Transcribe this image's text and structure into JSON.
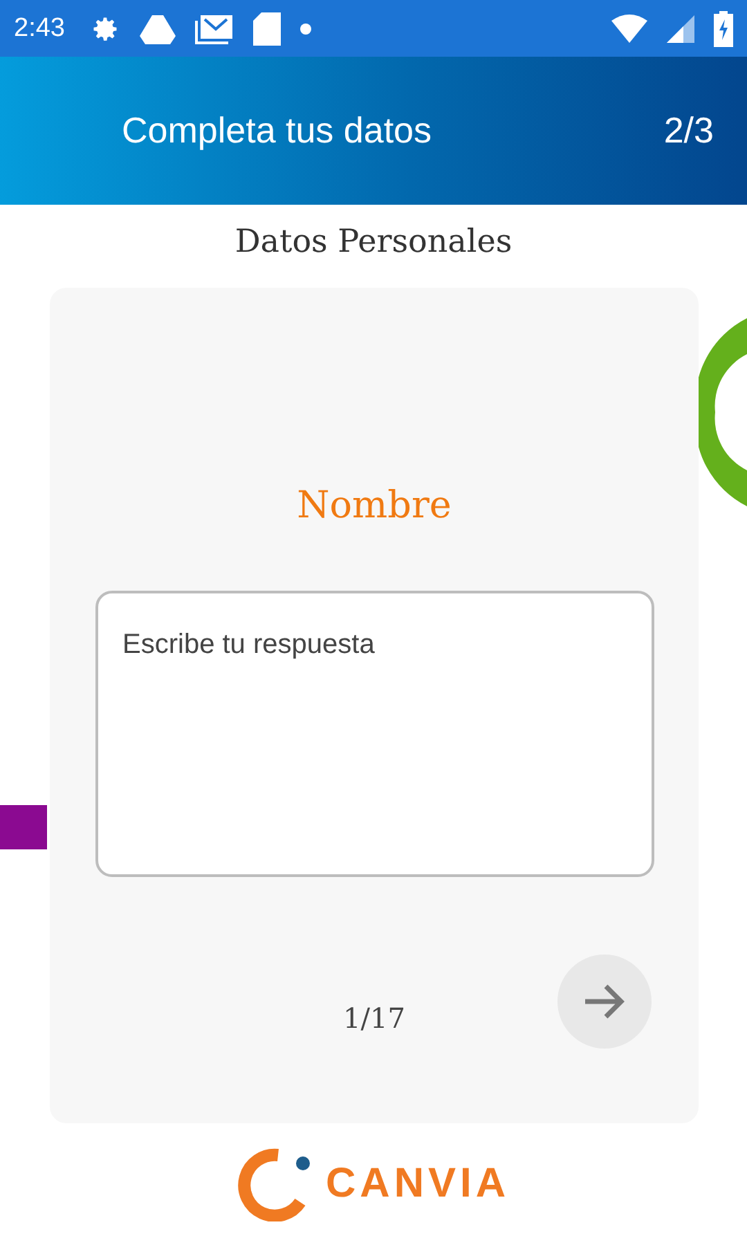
{
  "status_bar": {
    "time": "2:43"
  },
  "header": {
    "title": "Completa tus datos",
    "step": "2/3"
  },
  "section_title": "Datos Personales",
  "question": {
    "label": "Nombre",
    "placeholder": "Escribe tu respuesta",
    "counter": "1/17"
  },
  "logo": {
    "text": "CANVIA"
  }
}
